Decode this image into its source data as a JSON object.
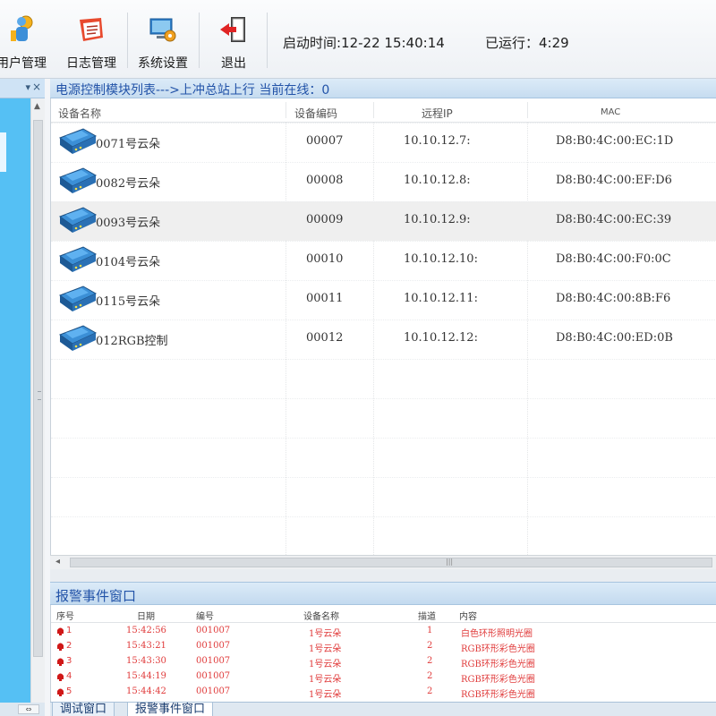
{
  "toolbar": {
    "buttons": [
      {
        "label": "用户管理",
        "icon": "user-key-icon"
      },
      {
        "label": "日志管理",
        "icon": "log-book-icon"
      },
      {
        "label": "系统设置",
        "icon": "settings-computer-icon"
      },
      {
        "label": "退出",
        "icon": "exit-door-icon"
      }
    ],
    "start_time": "启动时间:12-22 15:40:14",
    "uptime": "已运行：4:29"
  },
  "left_panel": {
    "pin": "▾",
    "close": "×",
    "footer_label": "⇔"
  },
  "device_panel": {
    "title": "电源控制模块列表--->上冲总站上行 当前在线：0",
    "columns": [
      "设备名称",
      "设备编码",
      "远程IP",
      "MAC"
    ],
    "rows": [
      {
        "name": "0071号云朵",
        "code": "00007",
        "ip": "10.10.12.7:",
        "mac": "D8:B0:4C:00:EC:1D",
        "icon": "network-device-icon"
      },
      {
        "name": "0082号云朵",
        "code": "00008",
        "ip": "10.10.12.8:",
        "mac": "D8:B0:4C:00:EF:D6",
        "icon": "network-device-icon"
      },
      {
        "name": "0093号云朵",
        "code": "00009",
        "ip": "10.10.12.9:",
        "mac": "D8:B0:4C:00:EC:39",
        "icon": "network-device-icon"
      },
      {
        "name": "0104号云朵",
        "code": "00010",
        "ip": "10.10.12.10:",
        "mac": "D8:B0:4C:00:F0:0C",
        "icon": "network-device-icon"
      },
      {
        "name": "0115号云朵",
        "code": "00011",
        "ip": "10.10.12.11:",
        "mac": "D8:B0:4C:00:8B:F6",
        "icon": "network-device-icon"
      },
      {
        "name": "012RGB控制",
        "code": "00012",
        "ip": "10.10.12.12:",
        "mac": "D8:B0:4C:00:ED:0B",
        "icon": "network-device-icon"
      }
    ],
    "selected_row": 2
  },
  "alarm_panel": {
    "title": "报警事件窗口",
    "columns": [
      "序号",
      "日期",
      "编号",
      "设备名称",
      "描道",
      "内容"
    ],
    "rows": [
      {
        "index": "1",
        "time": "15:42:56",
        "id": "001007",
        "device": "1号云朵",
        "channel": "1",
        "content": "白色环形照明光圈"
      },
      {
        "index": "2",
        "time": "15:43:21",
        "id": "001007",
        "device": "1号云朵",
        "channel": "2",
        "content": "RGB环形彩色光圈"
      },
      {
        "index": "3",
        "time": "15:43:30",
        "id": "001007",
        "device": "1号云朵",
        "channel": "2",
        "content": "RGB环形彩色光圈"
      },
      {
        "index": "4",
        "time": "15:44:19",
        "id": "001007",
        "device": "1号云朵",
        "channel": "2",
        "content": "RGB环形彩色光圈"
      },
      {
        "index": "5",
        "time": "15:44:42",
        "id": "001007",
        "device": "1号云朵",
        "channel": "2",
        "content": "RGB环形彩色光圈"
      }
    ]
  },
  "bottom_tabs": [
    "调试窗口",
    "报警事件窗口"
  ],
  "active_tab": 1,
  "colors": {
    "accent_blue": "#55c0f4",
    "header_text": "#2253a8",
    "alarm_red": "#e03b3b"
  }
}
